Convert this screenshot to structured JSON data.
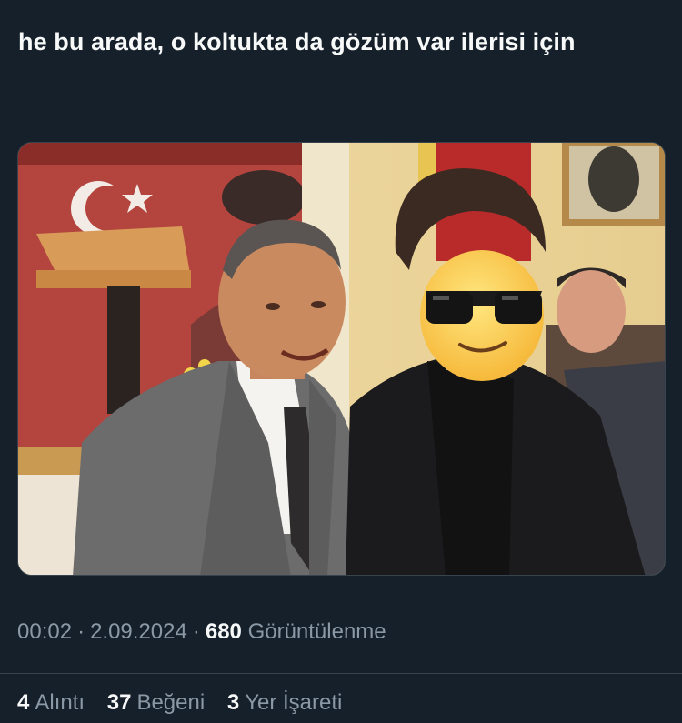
{
  "tweet": {
    "text": "he bu arada, o koltukta da gözüm var ilerisi için",
    "time": "00:02",
    "separator": "·",
    "date": "2.09.2024",
    "views_count": "680",
    "views_label": "Görüntülenme"
  },
  "media": {
    "icon": "emoji-sunglasses-face-icon"
  },
  "stats": [
    {
      "count": "4",
      "label": "Alıntı"
    },
    {
      "count": "37",
      "label": "Beğeni"
    },
    {
      "count": "3",
      "label": "Yer İşareti"
    }
  ],
  "colors": {
    "background": "#15202b",
    "text_primary": "#f7f9f9",
    "text_secondary": "#8b98a5",
    "border": "#38444d"
  }
}
